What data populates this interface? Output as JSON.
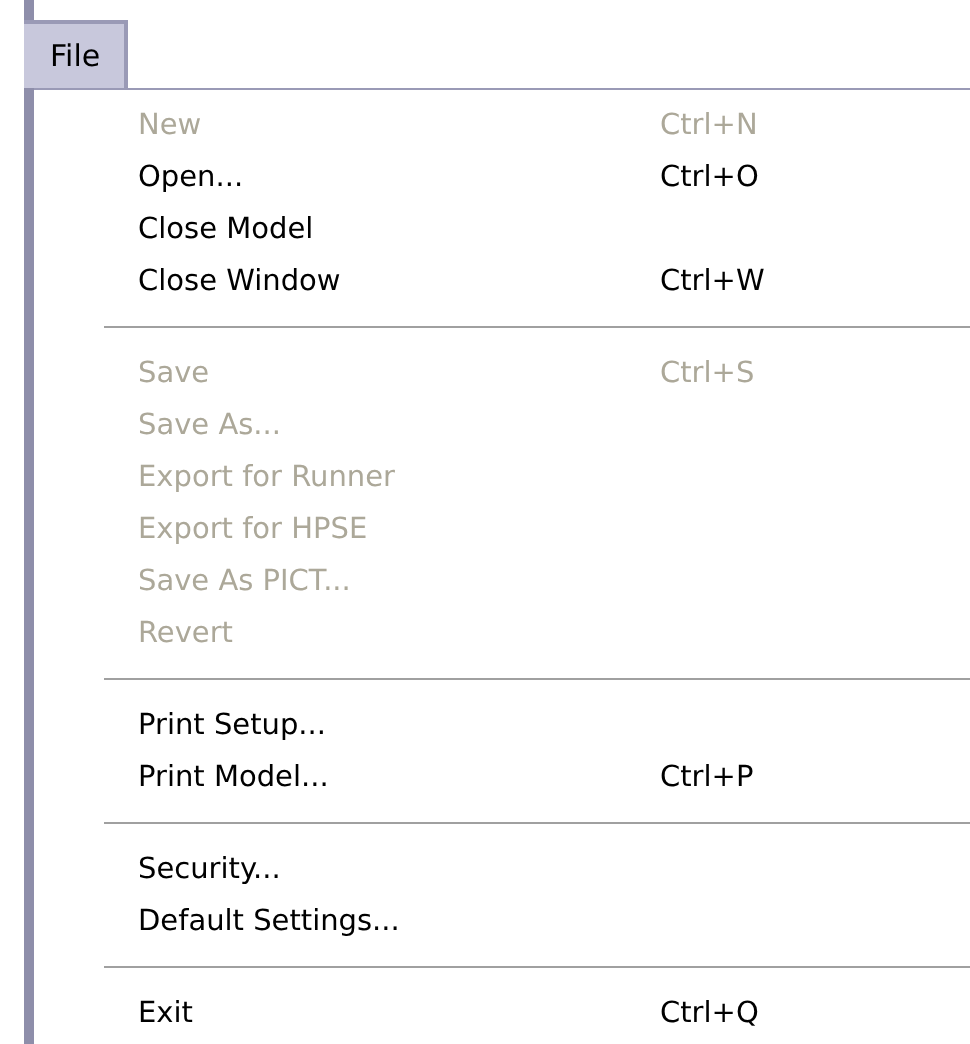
{
  "menu": {
    "title": "File",
    "selected": true
  },
  "groups": [
    {
      "items": [
        {
          "label": "New",
          "shortcut": "Ctrl+N",
          "disabled": true
        },
        {
          "label": "Open...",
          "shortcut": "Ctrl+O",
          "disabled": false
        },
        {
          "label": "Close Model",
          "disabled": false
        },
        {
          "label": "Close Window",
          "shortcut": "Ctrl+W",
          "disabled": false
        }
      ]
    },
    {
      "items": [
        {
          "label": "Save",
          "shortcut": "Ctrl+S",
          "disabled": true
        },
        {
          "label": "Save As...",
          "disabled": true
        },
        {
          "label": "Export for Runner",
          "disabled": true
        },
        {
          "label": "Export for HPSE",
          "disabled": true
        },
        {
          "label": "Save As PICT...",
          "disabled": true
        },
        {
          "label": "Revert",
          "disabled": true
        }
      ]
    },
    {
      "items": [
        {
          "label": "Print Setup...",
          "disabled": false
        },
        {
          "label": "Print Model...",
          "shortcut": "Ctrl+P",
          "disabled": false
        }
      ]
    },
    {
      "items": [
        {
          "label": "Security...",
          "disabled": false
        },
        {
          "label": "Default Settings...",
          "disabled": false
        }
      ]
    },
    {
      "items": [
        {
          "label": "Exit",
          "shortcut": "Ctrl+Q",
          "disabled": false
        }
      ]
    }
  ]
}
